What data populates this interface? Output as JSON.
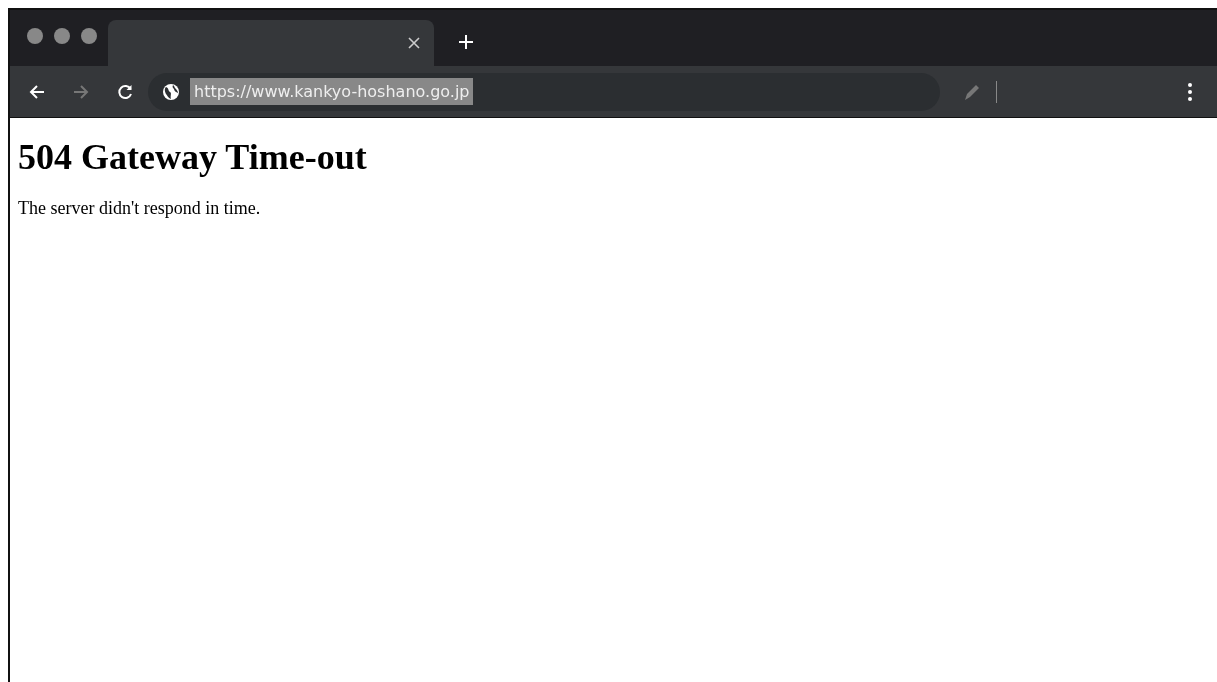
{
  "tab": {
    "selected": true
  },
  "toolbar": {
    "back_disabled": false,
    "forward_disabled": true,
    "address": {
      "value": "https://www.kankyo-hoshano.go.jp",
      "selected": true
    }
  },
  "page": {
    "heading": "504 Gateway Time-out",
    "message": "The server didn't respond in time."
  }
}
